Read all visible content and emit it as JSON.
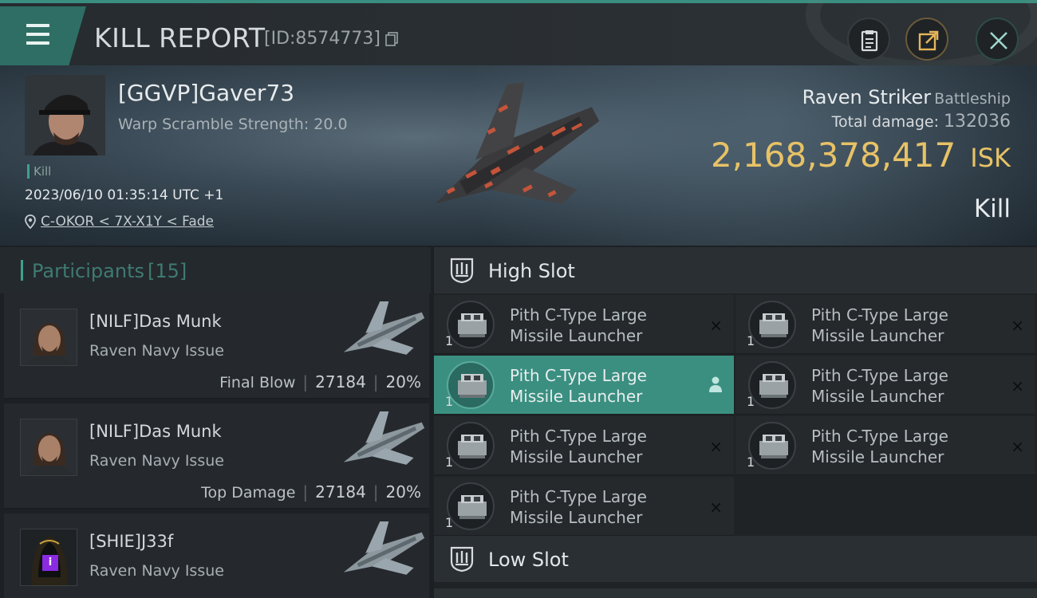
{
  "header": {
    "title": "KILL REPORT",
    "report_id": "[ID:8574773]"
  },
  "victim": {
    "name": "[GGVP]Gaver73",
    "warp_scramble": "Warp Scramble Strength: 20.0",
    "tag": "Kill",
    "timestamp": "2023/06/10 01:35:14 UTC +1",
    "location": "C-OKOR < 7X-X1Y < Fade",
    "ship_name": "Raven Striker",
    "ship_class": "Battleship",
    "total_damage_label": "Total damage:",
    "total_damage": "132036",
    "isk_value": "2,168,378,417",
    "isk_unit": "ISK",
    "result": "Kill"
  },
  "participants": {
    "title": "Participants",
    "count": "[15]",
    "rows": [
      {
        "name": "[NILF]Das Munk",
        "ship": "Raven Navy Issue",
        "label": "Final Blow",
        "damage": "27184",
        "percent": "20%"
      },
      {
        "name": "[NILF]Das Munk",
        "ship": "Raven Navy Issue",
        "label": "Top Damage",
        "damage": "27184",
        "percent": "20%"
      },
      {
        "name": "[SHIE]J33f",
        "ship": "Raven Navy Issue",
        "badge": "i"
      }
    ]
  },
  "fitting": {
    "high_slot_title": "High Slot",
    "low_slot_title": "Low Slot",
    "modules": [
      {
        "name": "Pith C-Type Large Missile Launcher",
        "qty": "1",
        "status": "×"
      },
      {
        "name": "Pith C-Type Large Missile Launcher",
        "qty": "1",
        "status": "×"
      },
      {
        "name": "Pith C-Type Large Missile Launcher",
        "qty": "1",
        "status": "pilot-icon"
      },
      {
        "name": "Pith C-Type Large Missile Launcher",
        "qty": "1",
        "status": "×"
      },
      {
        "name": "Pith C-Type Large Missile Launcher",
        "qty": "1",
        "status": "×"
      },
      {
        "name": "Pith C-Type Large Missile Launcher",
        "qty": "1",
        "status": "×"
      },
      {
        "name": "Pith C-Type Large Missile Launcher",
        "qty": "1",
        "status": "×"
      }
    ]
  },
  "colors": {
    "accent": "#3fa08f",
    "isk": "#e7c266",
    "active_module": "#3b8f81"
  }
}
